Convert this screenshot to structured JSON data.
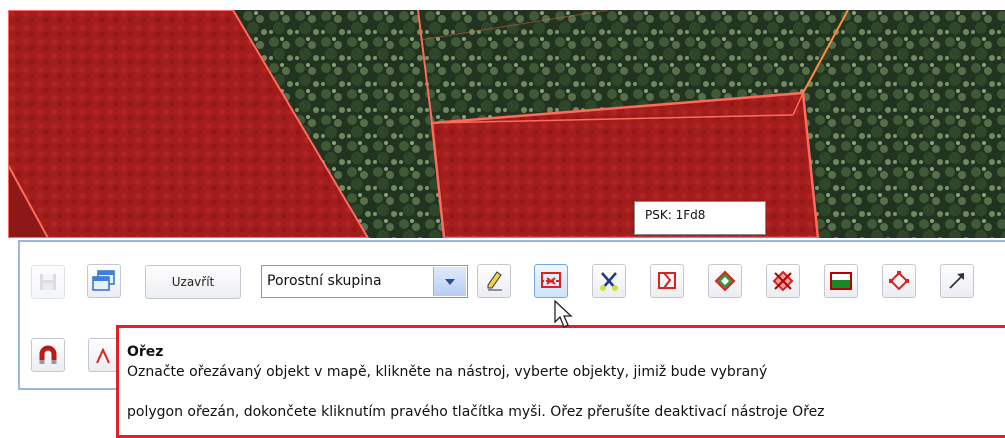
{
  "map": {
    "label": "PSK: 1Fd8"
  },
  "toolbar": {
    "close_label": "Uzavřít",
    "layer_select_value": "Porostní skupina"
  },
  "tooltip": {
    "title": "Ořez",
    "line1": "Označte ořezávaný objekt v mapě, klikněte na nástroj, vyberte objekty, jimiž bude vybraný",
    "line2": "polygon ořezán, dokončete kliknutím pravého tlačítka myši. Ořez přerušíte deaktivací nástroje Ořez"
  },
  "colors": {
    "polygon_fill": "#a01c1c",
    "polygon_edge": "#ff6a5e",
    "forest": "#20301f",
    "panel_border": "#9bb6dc",
    "tooltip_border": "#e2202a"
  },
  "icons": [
    "save-icon",
    "window-icon",
    "pencil-icon",
    "cut-icon",
    "scissors-icon",
    "split-icon",
    "polygon-icon",
    "delete-polygon-icon",
    "fill-polygon-icon",
    "vertex-icon",
    "arrow-icon",
    "magnet-icon",
    "snap-icon"
  ]
}
